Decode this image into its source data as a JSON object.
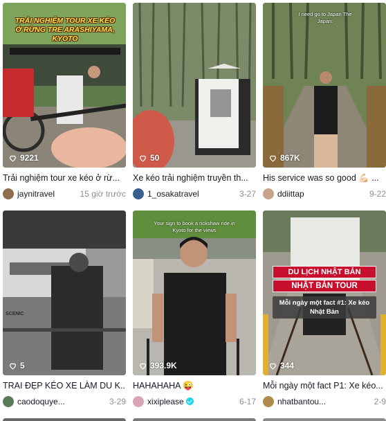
{
  "videos": [
    {
      "views": "9221",
      "title": "Trải nghiệm tour xe kéo ở rừ...",
      "author": "jaynitravel",
      "date": "15 giờ trước",
      "overlay": "TRẢI NGHIỆM TOUR XE KÉO Ở RỪNG TRE ARASHIYAMA, KYOTO",
      "verified": false
    },
    {
      "views": "50",
      "title": "Xe kéo trải nghiệm truyền th...",
      "author": "1_osakatravel",
      "date": "3-27",
      "verified": false
    },
    {
      "views": "867K",
      "title": "His service was so good 💪🏻 ...",
      "author": "ddiittap",
      "date": "9-22",
      "overlay": "I need go to Japan The Japan:",
      "verified": false
    },
    {
      "views": "5",
      "title": "TRAI ĐẸP KÉO XE LÀM DU K...",
      "author": "caodoquye...",
      "date": "3-29",
      "overlay": "SCENIC",
      "verified": false
    },
    {
      "views": "393.9K",
      "title": "HAHAHAHA 😜",
      "author": "xixiplease",
      "date": "6-17",
      "overlay": "Your sign to book a rickshaw ride in Kyoto for the views",
      "verified": true
    },
    {
      "views": "344",
      "title": "Mỗi ngày một fact P1: Xe kéo...",
      "author": "nhatbantou...",
      "date": "2-9",
      "banner1": "DU LỊCH NHẬT BẢN",
      "banner2": "NHẬT BẢN TOUR",
      "banner3": "Mỗi ngày một fact #1: Xe kéo Nhật Bản",
      "verified": false
    }
  ],
  "icons": {
    "views": "heart-outline-icon",
    "verified": "verified-badge-icon"
  },
  "colors": {
    "verified": "#20d5ec",
    "date_text": "#8a8b91",
    "banner_red": "#c8102e"
  }
}
